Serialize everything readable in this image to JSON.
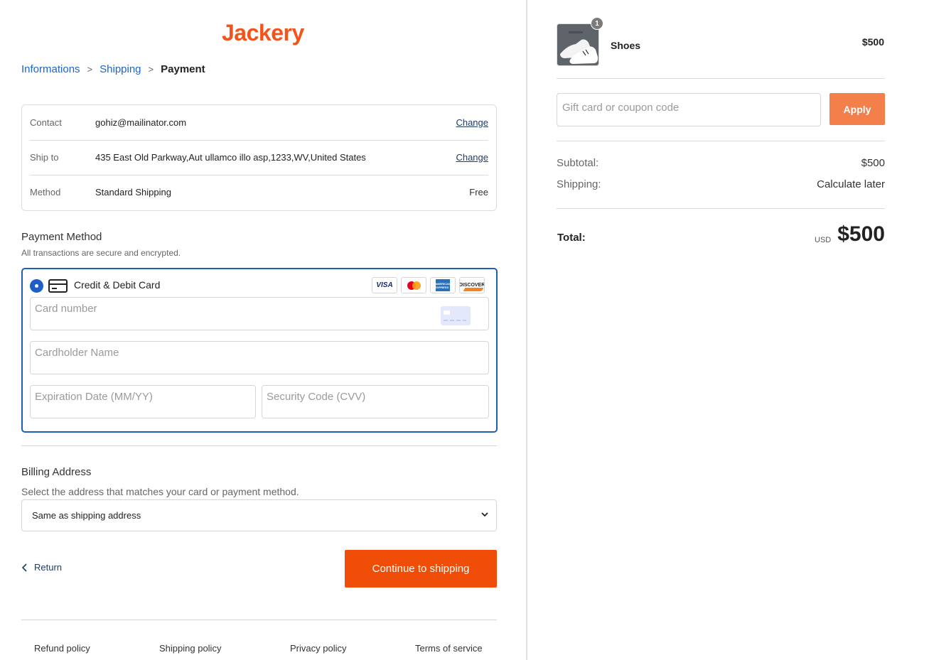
{
  "brand": {
    "logo": "Jackery",
    "accent": "#f04e08"
  },
  "breadcrumb": {
    "step1": "Informations",
    "step2": "Shipping",
    "step3": "Payment",
    "separator": ">"
  },
  "summary_box": {
    "contact": {
      "label": "Contact",
      "value": "gohiz@mailinator.com",
      "action": "Change"
    },
    "ship_to": {
      "label": "Ship to",
      "value": "435 East Old Parkway,Aut ullamco illo asp,1233,WV,United States",
      "action": "Change"
    },
    "method": {
      "label": "Method",
      "value": "Standard Shipping",
      "price": "Free"
    }
  },
  "payment": {
    "title": "Payment Method",
    "subtitle": "All transactions are secure and encrypted.",
    "option_label": "Credit & Debit Card",
    "brands": {
      "visa": "VISA",
      "amex": "AMERICAN EXPRESS",
      "discover": "DISCOVER"
    },
    "card_number_placeholder": "Card number",
    "cardholder_placeholder": "Cardholder Name",
    "expiry_placeholder": "Expiration Date (MM/YY)",
    "cvv_placeholder": "Security Code (CVV)"
  },
  "billing": {
    "title": "Billing Address",
    "subtitle": "Select the address that matches your card or payment method.",
    "selected": "Same as shipping address"
  },
  "actions": {
    "return_label": "Return",
    "continue_label": "Continue to shipping"
  },
  "footer": {
    "refund": "Refund policy",
    "shipping": "Shipping policy",
    "privacy": "Privacy policy",
    "terms": "Terms of service"
  },
  "cart": {
    "item_name": "Shoes",
    "item_qty": "1",
    "item_price": "$500",
    "coupon_placeholder": "Gift card or coupon code",
    "apply_label": "Apply",
    "subtotal_label": "Subtotal:",
    "subtotal_value": "$500",
    "shipping_label": "Shipping:",
    "shipping_value": "Calculate later",
    "total_label": "Total:",
    "total_currency": "USD",
    "total_value": "$500"
  }
}
